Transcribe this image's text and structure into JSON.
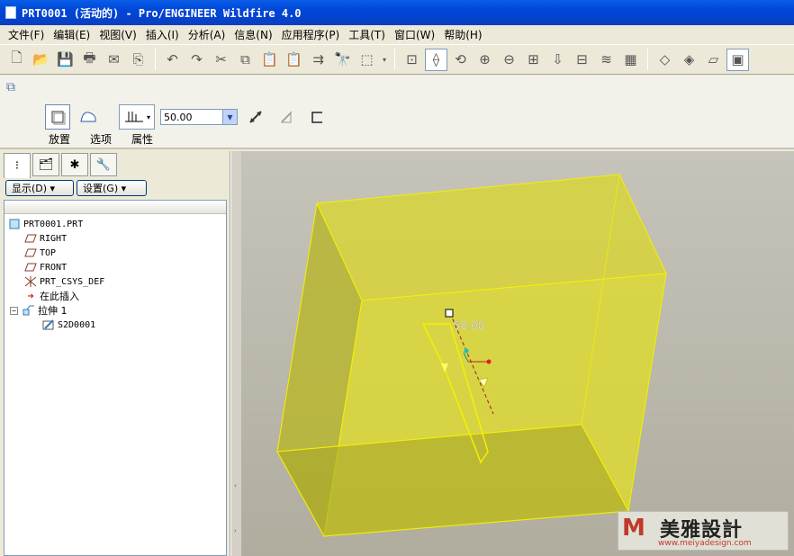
{
  "window": {
    "title": "PRT0001 (活动的) - Pro/ENGINEER Wildfire 4.0"
  },
  "menu": [
    "文件(F)",
    "编辑(E)",
    "视图(V)",
    "插入(I)",
    "分析(A)",
    "信息(N)",
    "应用程序(P)",
    "工具(T)",
    "窗口(W)",
    "帮助(H)"
  ],
  "dashboard": {
    "depth_value": "50.00",
    "tabs": [
      "放置",
      "选项",
      "属性"
    ]
  },
  "panel": {
    "show_button": "显示(D) ▾",
    "settings_button": "设置(G) ▾"
  },
  "tree": {
    "root": "PRT0001.PRT",
    "items": [
      "RIGHT",
      "TOP",
      "FRONT",
      "PRT_CSYS_DEF",
      "在此插入",
      "拉伸 1",
      "S2D0001"
    ]
  },
  "viewport": {
    "dimension_label": "50.00",
    "model_color": "#e6e32a",
    "edge_color": "#f5f000"
  },
  "watermark": {
    "title": "美雅設計",
    "url": "www.meiyadesign.com"
  }
}
